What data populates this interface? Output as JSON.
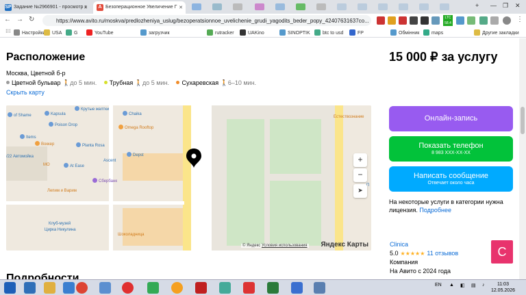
{
  "browser": {
    "tabs": [
      {
        "favicon": "SP",
        "title": "Задание №2966901 - просмотр з",
        "active": false
      },
      {
        "favicon": "A",
        "title": "Безоперационное Увеличение Г",
        "active": true
      }
    ],
    "url": "https://www.avito.ru/moskva/predlozheniya_uslug/bezoperatsionnoe_uvelichenie_grudi_yagodits_beder_popy_42407631637co...",
    "ext_badge": "LTC 58.4",
    "bookmarks": [
      "Настройки",
      "USA",
      "G",
      "YouTube",
      "загрузчик",
      "rutracker",
      "UAKino",
      "SINOPTIK",
      "btc to usd",
      "FP",
      "Обмінник",
      "maps",
      "Другие закладки"
    ]
  },
  "location": {
    "heading": "Расположение",
    "address": "Москва, Цветной б-р",
    "metro": [
      {
        "name": "Цветной бульвар",
        "time": "до 5 мин.",
        "color": "#9b9b9b"
      },
      {
        "name": "Трубная",
        "time": "до 5 мин.",
        "color": "#d7e02b"
      },
      {
        "name": "Сухаревская",
        "time": "6–10 мин.",
        "color": "#f08c2a"
      }
    ],
    "hide_map": "Скрыть карту"
  },
  "map": {
    "pois": [
      {
        "label": "of Shame",
        "kind": "blue"
      },
      {
        "label": "Крутые желтки",
        "kind": "blue"
      },
      {
        "label": "Chaika",
        "kind": "blue"
      },
      {
        "label": "Kapsula",
        "kind": "blue"
      },
      {
        "label": "Poison Drop",
        "kind": "blue"
      },
      {
        "label": "Omega Rooftop",
        "kind": "orange"
      },
      {
        "label": "Items",
        "kind": "blue"
      },
      {
        "label": "Воккер",
        "kind": "orange"
      },
      {
        "label": "Planta Rosa",
        "kind": "blue"
      },
      {
        "label": "Depst",
        "kind": "blue"
      },
      {
        "label": "/22 Автомойка",
        "kind": "blue"
      },
      {
        "label": "At Ease",
        "kind": "blue"
      },
      {
        "label": "MO",
        "kind": "orange"
      },
      {
        "label": "Ascent",
        "kind": "blue"
      },
      {
        "label": "Сбербанк",
        "kind": "purple"
      },
      {
        "label": "Лепим и Варим",
        "kind": "orange"
      },
      {
        "label": "Клуб-музей",
        "kind": "blue"
      },
      {
        "label": "Цирка Никулина",
        "kind": "blue"
      },
      {
        "label": "Шоколадница",
        "kind": "orange"
      },
      {
        "label": "Естествознание",
        "kind": "orange"
      },
      {
        "label": "П",
        "kind": "blue"
      }
    ],
    "copyright": "© Яндекс",
    "terms": "Условия использования",
    "logo": "Яндекс Карты"
  },
  "details_heading": "Подробности",
  "sidebar": {
    "price": "15 000 ₽ за услугу",
    "online_booking": "Онлайн-запись",
    "show_phone": "Показать телефон",
    "phone_masked": "8 983 XXX-XX-XX",
    "write_message": "Написать сообщение",
    "reply_time": "Отвечает около часа",
    "license_text": "На некоторые услуги в категории нужна лицензия.",
    "license_link": "Подробнее",
    "colors": {
      "purple": "#985bf0",
      "green": "#02c23a",
      "blue": "#00aaff"
    }
  },
  "seller": {
    "name": "Clinica",
    "rating": "5.0",
    "stars": "★★★★★",
    "reviews": "11 отзывов",
    "type": "Компания",
    "since": "На Авито с 2024 года",
    "avatar_letter": "C"
  },
  "taskbar": {
    "lang": "EN",
    "time": "11:03",
    "date": "12.05.2026"
  }
}
